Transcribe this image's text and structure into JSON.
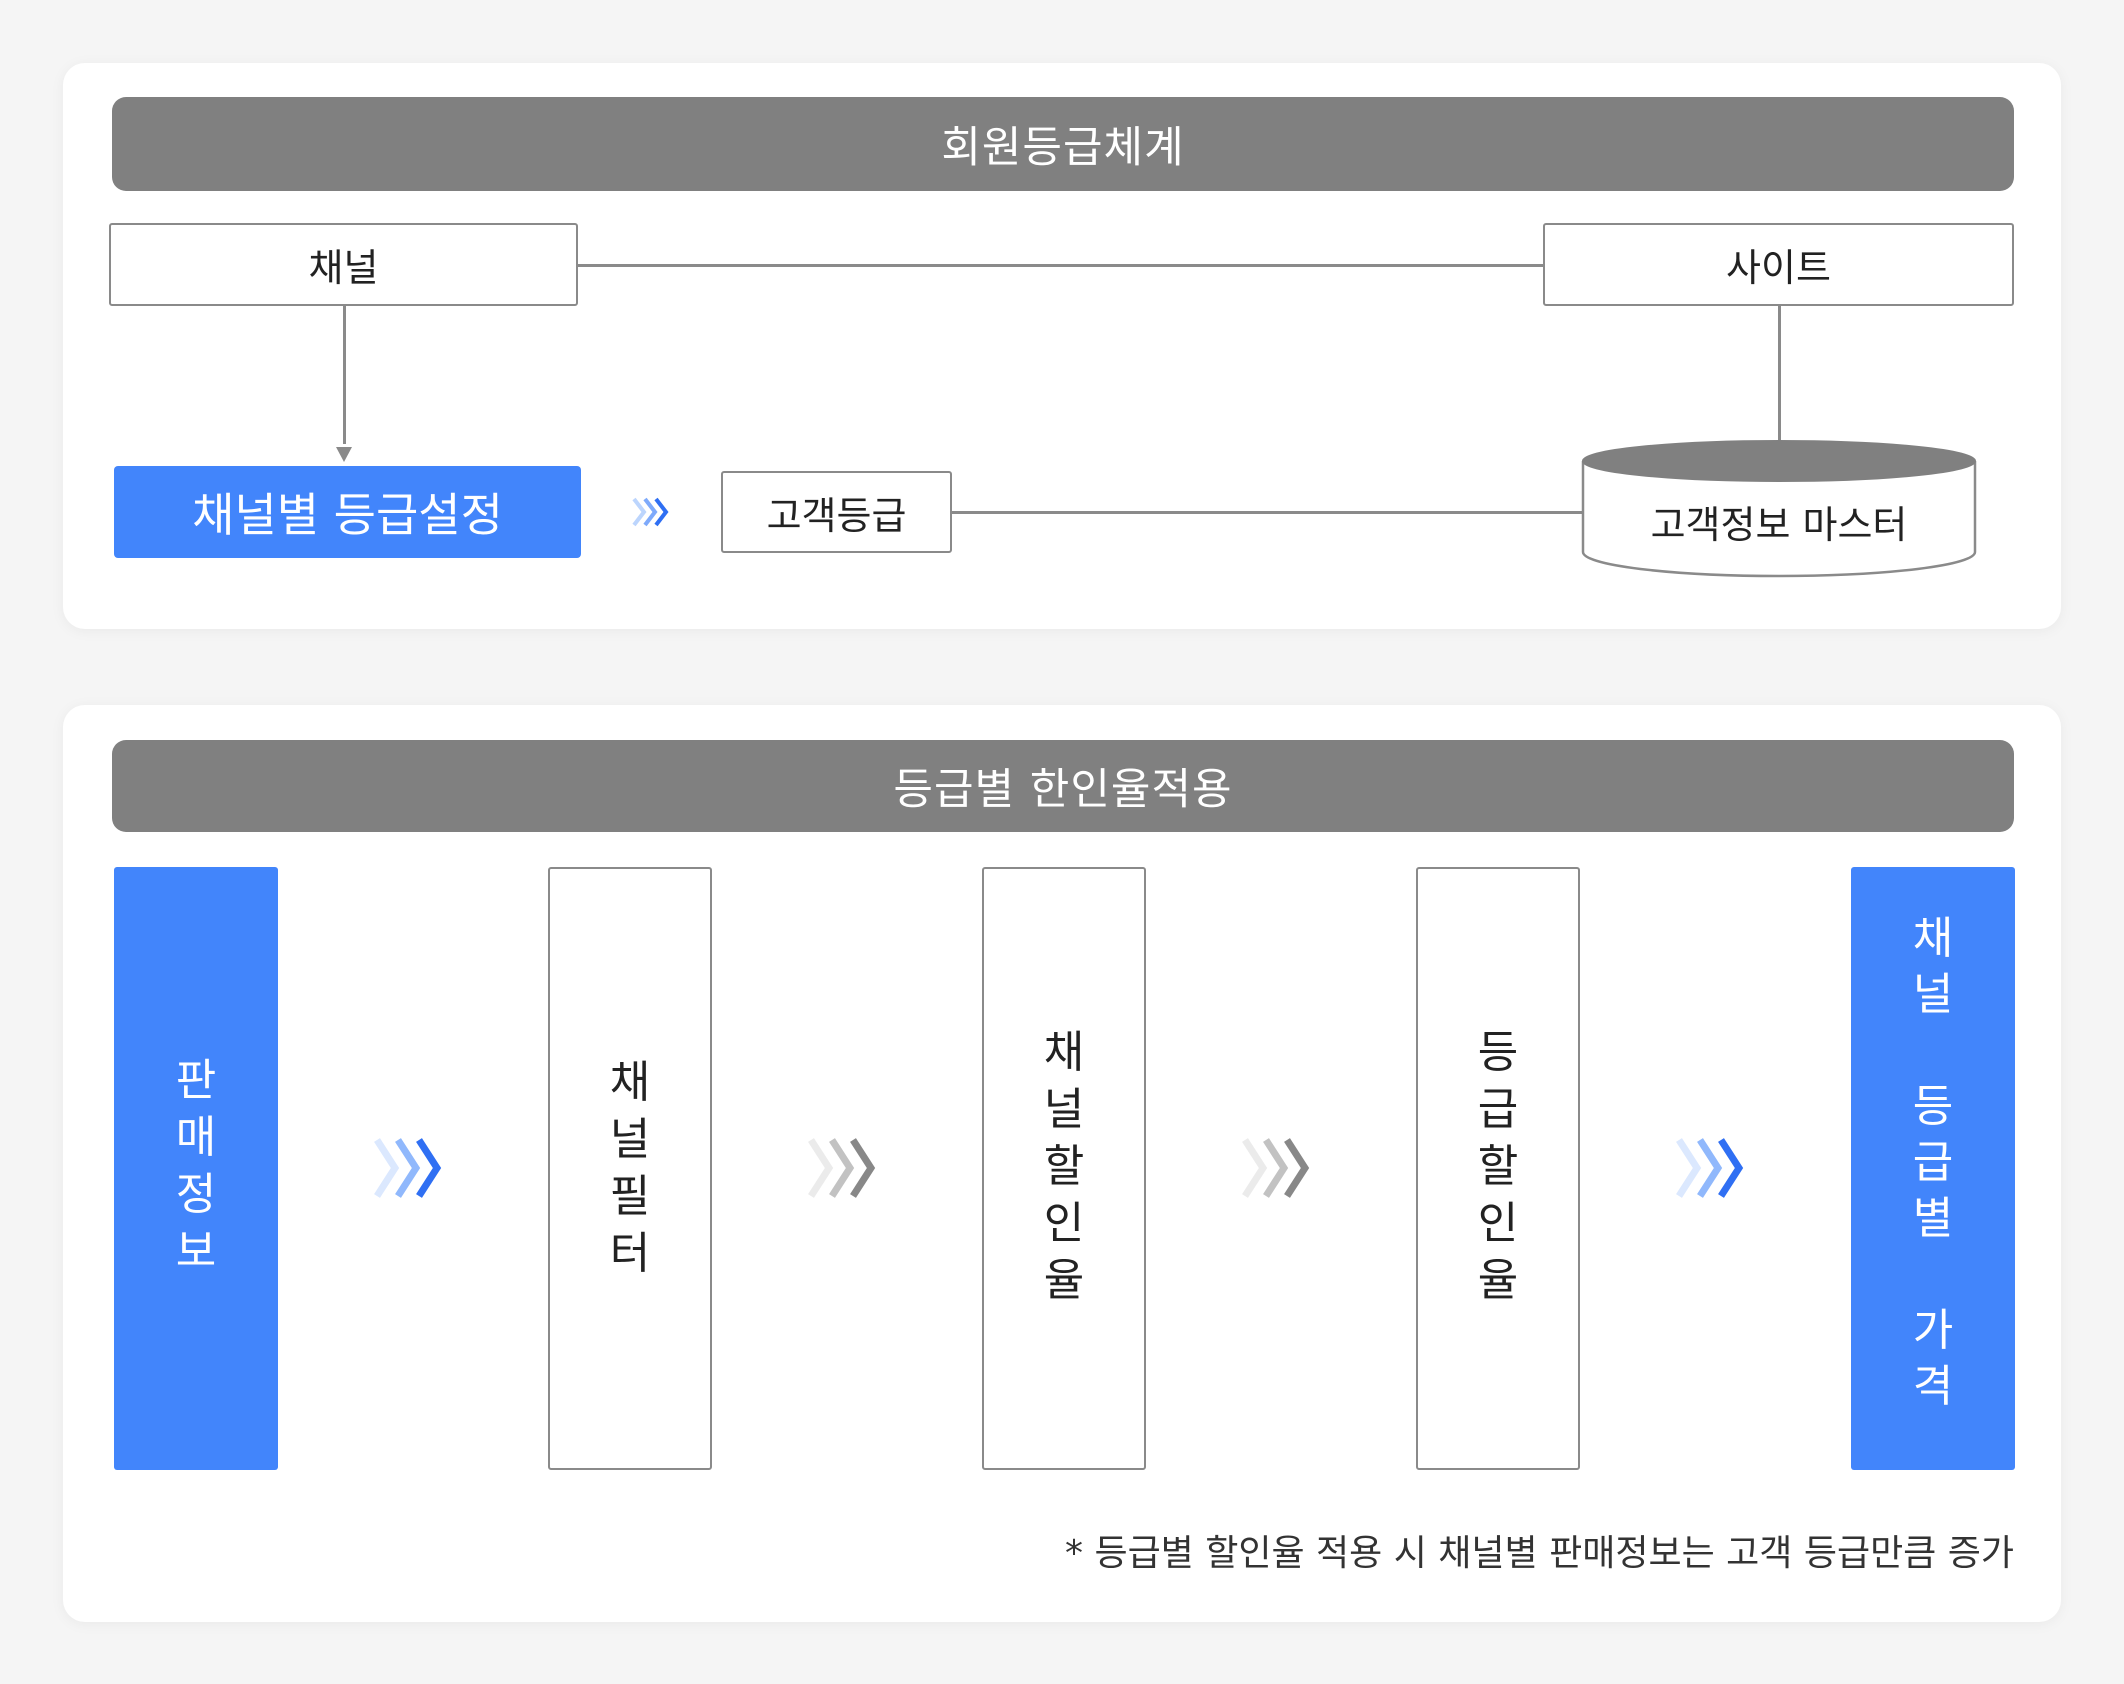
{
  "section1": {
    "title": "회원등급체계",
    "channel": "채널",
    "site": "사이트",
    "channel_grade_setting": "채널별 등급설정",
    "customer_grade": "고객등급",
    "customer_master": "고객정보 마스터"
  },
  "section2": {
    "title": "등급별 한인율적용",
    "steps": [
      {
        "label": "판\n매\n정\n보"
      },
      {
        "label": "채\n널\n필\n터"
      },
      {
        "label": "채\n널\n할\n인\n율"
      },
      {
        "label": "등\n급\n할\n인\n율"
      },
      {
        "label": "채\n널\n\n등\n급\n별\n\n가\n격"
      }
    ],
    "note": "* 등급별 할인율 적용 시 채널별 판매정보는 고객 등급만큼 증가"
  },
  "colors": {
    "accent_blue": "#4285fb",
    "header_gray": "#808080",
    "line_gray": "#8a8a8a"
  },
  "icons": [
    "arrow-down-icon",
    "chevron-triple-icon",
    "database-cylinder-icon"
  ]
}
